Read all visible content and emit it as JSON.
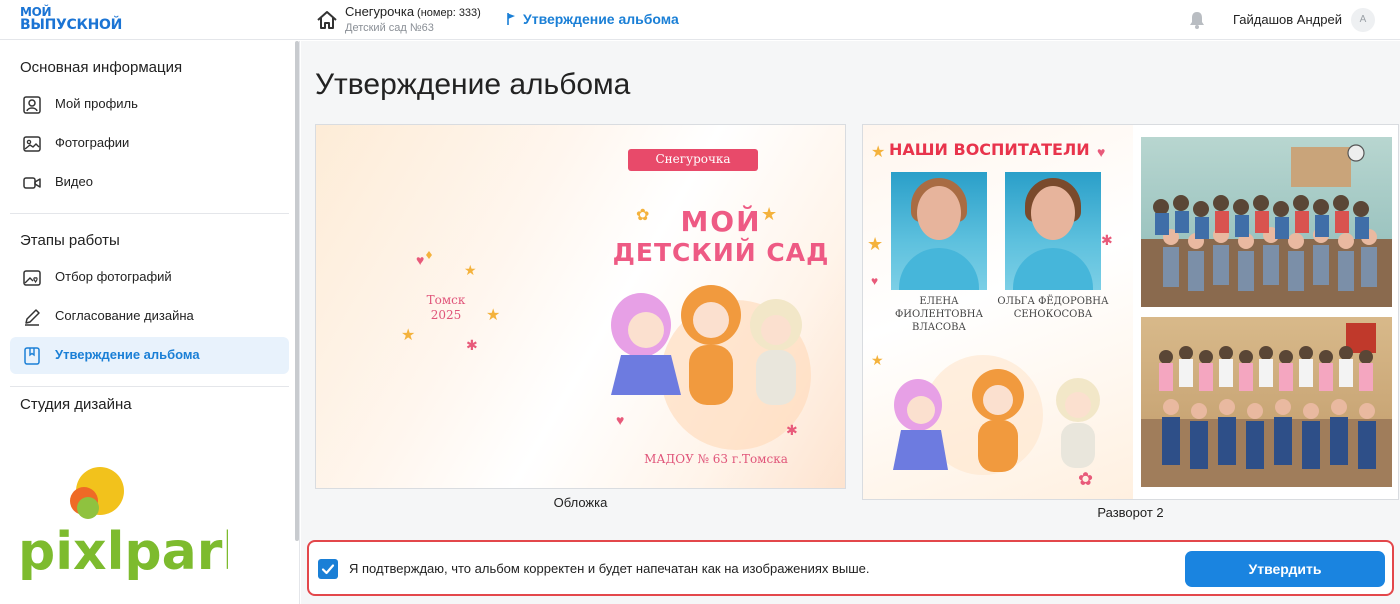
{
  "header": {
    "logo_line1": "МОЙ",
    "logo_line2": "ВЫПУСКНОЙ",
    "group_name": "Снегурочка",
    "group_number": "(номер: 333)",
    "group_subtitle": "Детский сад №63",
    "current_page": "Утверждение альбома",
    "user_name": "Гайдашов Андрей",
    "avatar_initial": "А"
  },
  "sidebar": {
    "section_main": "Основная информация",
    "main_items": [
      {
        "label": "Мой профиль",
        "icon": "profile-icon"
      },
      {
        "label": "Фотографии",
        "icon": "photos-icon"
      },
      {
        "label": "Видео",
        "icon": "video-icon"
      }
    ],
    "section_stages": "Этапы работы",
    "stage_items": [
      {
        "label": "Отбор фотографий",
        "icon": "photo-select-icon"
      },
      {
        "label": "Согласование дизайна",
        "icon": "pencil-icon"
      },
      {
        "label": "Утверждение альбома",
        "icon": "bookmark-icon",
        "active": true
      }
    ],
    "section_studio": "Студия дизайна",
    "brand": "pixlpark"
  },
  "main": {
    "title": "Утверждение альбома",
    "cover": {
      "caption": "Обложка",
      "ribbon": "Снегурочка",
      "title_line1": "МОЙ",
      "title_line2": "ДЕТСКИЙ САД",
      "city": "Томск",
      "year": "2025",
      "bottom_text": "МАДОУ № 63 г.Томска"
    },
    "spread": {
      "caption": "Разворот 2",
      "title": "НАШИ ВОСПИТАТЕЛИ",
      "teachers": [
        {
          "name_line1": "ЕЛЕНА ФИОЛЕНТОВНА",
          "name_line2": "ВЛАСОВА"
        },
        {
          "name_line1": "ОЛЬГА ФЁДОРОВНА",
          "name_line2": "СЕНОКОСОВА"
        }
      ]
    }
  },
  "confirm": {
    "checked": true,
    "text": "Я подтверждаю, что альбом корректен и будет напечатан как на изображениях выше.",
    "button": "Утвердить"
  },
  "colors": {
    "accent": "#1a7fd6",
    "highlight_border": "#e3474b",
    "cover_pink": "#ee5a84",
    "spread_title_red": "#e8344c"
  }
}
